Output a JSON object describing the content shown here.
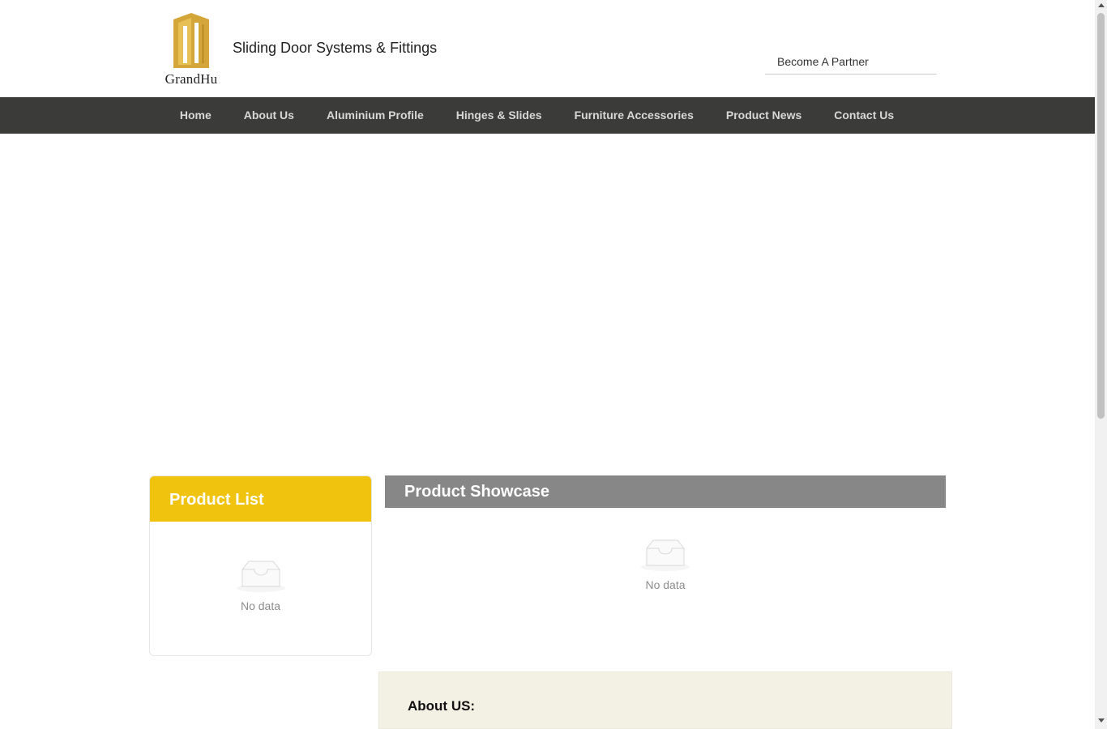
{
  "header": {
    "logo_text": "GrandHu",
    "tagline": "Sliding Door Systems & Fittings",
    "partner_link": "Become A Partner",
    "brand_color": "#d4a63a"
  },
  "nav": {
    "items": [
      {
        "label": "Home"
      },
      {
        "label": "About Us"
      },
      {
        "label": "Aluminium Profile"
      },
      {
        "label": "Hinges & Slides"
      },
      {
        "label": "Furniture Accessories"
      },
      {
        "label": "Product News"
      },
      {
        "label": "Contact Us"
      }
    ],
    "bg_color": "#3b3c3a"
  },
  "product_list": {
    "title": "Product List",
    "empty_text": "No data",
    "accent_color": "#f0c30f"
  },
  "showcase": {
    "title": "Product Showcase",
    "empty_text": "No data",
    "header_color": "#878787"
  },
  "about": {
    "title": "About US:"
  }
}
